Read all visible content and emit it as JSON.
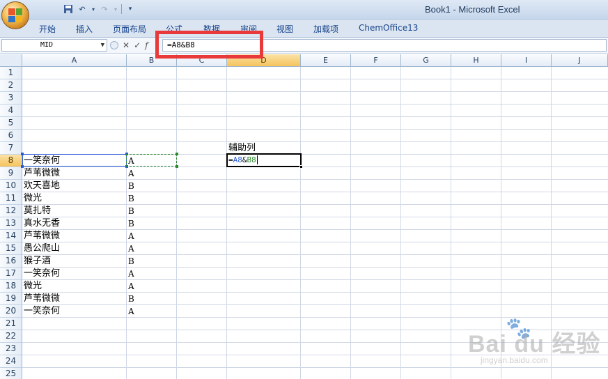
{
  "window": {
    "title": "Book1 - Microsoft Excel"
  },
  "ribbon_tabs": [
    "开始",
    "插入",
    "页面布局",
    "公式",
    "数据",
    "审阅",
    "视图",
    "加载项",
    "ChemOffice13"
  ],
  "formula_bar": {
    "name_box": "MID",
    "formula": "=A8&B8"
  },
  "columns": [
    "A",
    "B",
    "C",
    "D",
    "E",
    "F",
    "G",
    "H",
    "I",
    "J"
  ],
  "rows": [
    "1",
    "2",
    "3",
    "4",
    "5",
    "6",
    "7",
    "8",
    "9",
    "10",
    "11",
    "12",
    "13",
    "14",
    "15",
    "16",
    "17",
    "18",
    "19",
    "20",
    "21",
    "22",
    "23",
    "24",
    "25"
  ],
  "cells": {
    "D7": "辅助列",
    "A8": "一笑奈何",
    "B8": "A",
    "A9": "芦苇微微",
    "B9": "A",
    "A10": "欢天喜地",
    "B10": "B",
    "A11": "微光",
    "B11": "B",
    "A12": "莫扎特",
    "B12": "B",
    "A13": "真水无香",
    "B13": "B",
    "A14": "芦苇微微",
    "B14": "A",
    "A15": "愚公爬山",
    "B15": "A",
    "A16": "猴子酒",
    "B16": "B",
    "A17": "一笑奈何",
    "B17": "A",
    "A18": "微光",
    "B18": "A",
    "A19": "芦苇微微",
    "B19": "B",
    "A20": "一笑奈何",
    "B20": "A"
  },
  "active_cell": {
    "ref": "D8",
    "formula_parts": [
      "=",
      "A8",
      "&",
      "B8"
    ]
  },
  "colors": {
    "ref_a": "#2a5bd7",
    "ref_b": "#2e8b2e",
    "highlight_box": "#e83a3a"
  },
  "watermark": {
    "logo": "Bai du 经验",
    "url": "jingyan.baidu.com"
  }
}
